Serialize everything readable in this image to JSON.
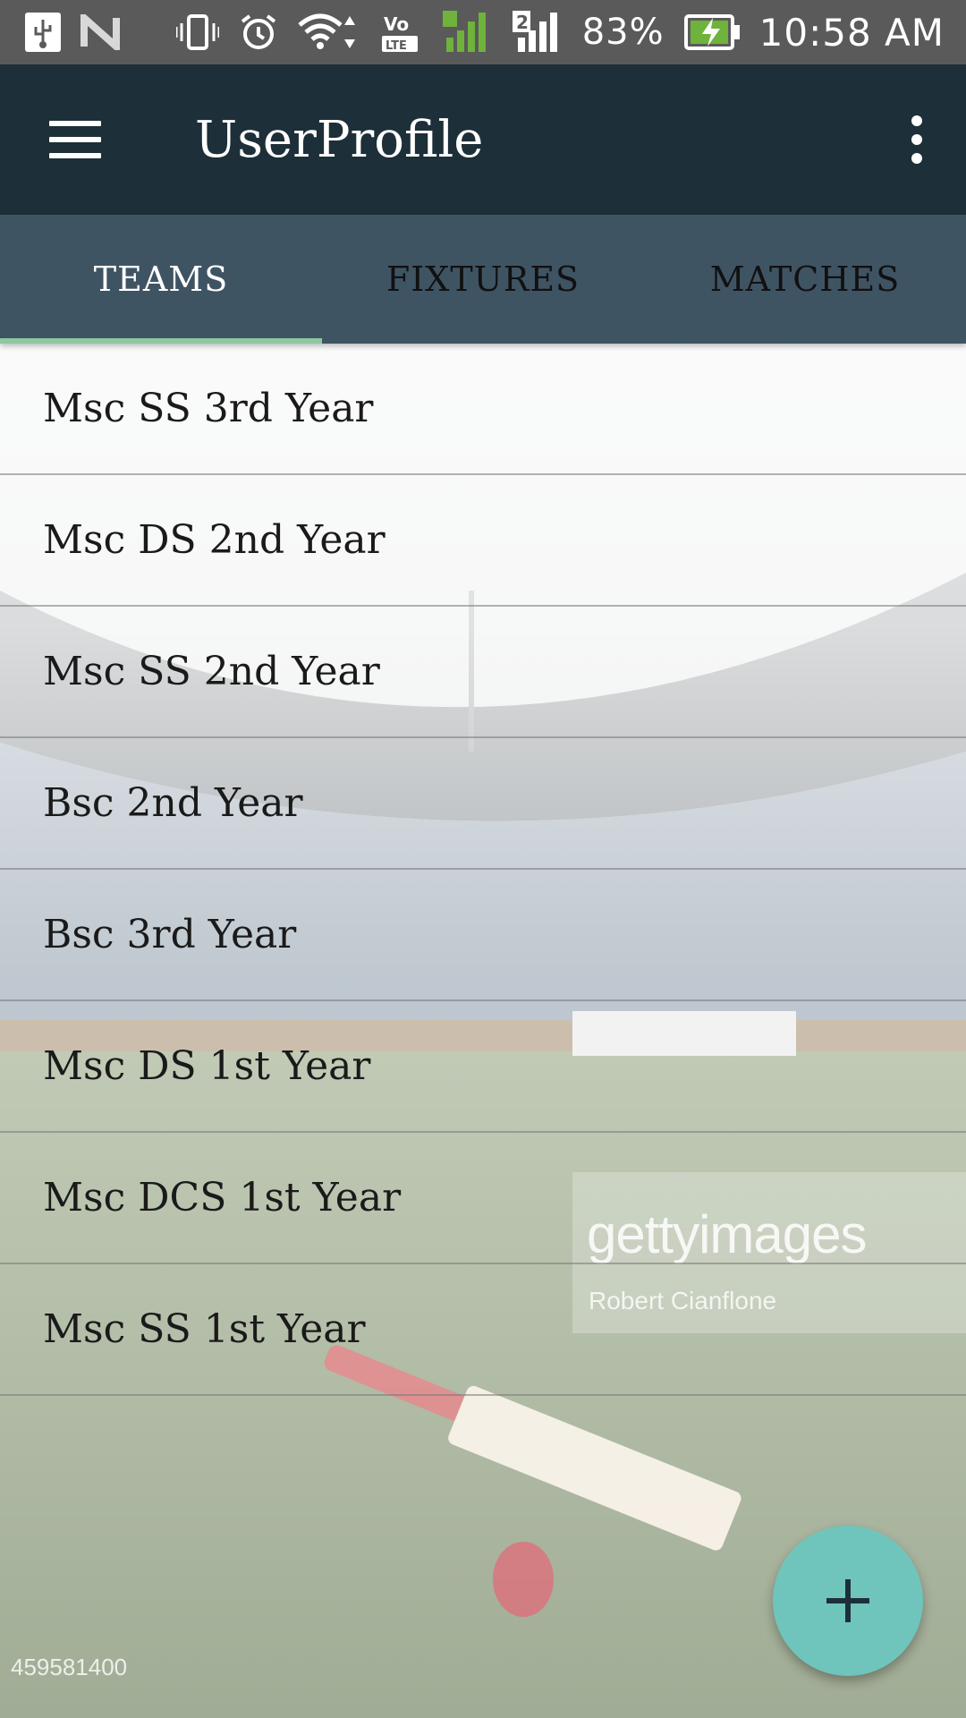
{
  "status_bar": {
    "battery_percent": "83%",
    "time": "10:58 AM",
    "sim_slot": "2",
    "icons": [
      "usb-icon",
      "nfc-icon",
      "vibrate-icon",
      "alarm-icon",
      "wifi-icon",
      "volte-icon",
      "signal-icon",
      "battery-charging-icon"
    ]
  },
  "app_bar": {
    "title": "UserProfile",
    "menu_icon": "hamburger-menu-icon",
    "overflow_icon": "more-vert-icon"
  },
  "tabs": [
    {
      "label": "TEAMS",
      "active": true
    },
    {
      "label": "FIXTURES",
      "active": false
    },
    {
      "label": "MATCHES",
      "active": false
    }
  ],
  "teams": [
    "Msc SS 3rd Year",
    "Msc DS 2nd Year",
    "Msc SS 2nd Year",
    "Bsc 2nd Year",
    "Bsc 3rd Year",
    "Msc DS 1st Year",
    "Msc DCS 1st Year",
    "Msc SS 1st Year"
  ],
  "fab": {
    "icon": "add-icon"
  },
  "background": {
    "watermark_brand": "gettyimages",
    "watermark_credit": "Robert Cianflone",
    "watermark_id": "459581400"
  },
  "colors": {
    "status_bar": "#5a5a5a",
    "app_bar": "#1d2f38",
    "tab_bar": "#3f5463",
    "tab_indicator": "#8cc8a0",
    "fab": "#6fc5bc"
  }
}
